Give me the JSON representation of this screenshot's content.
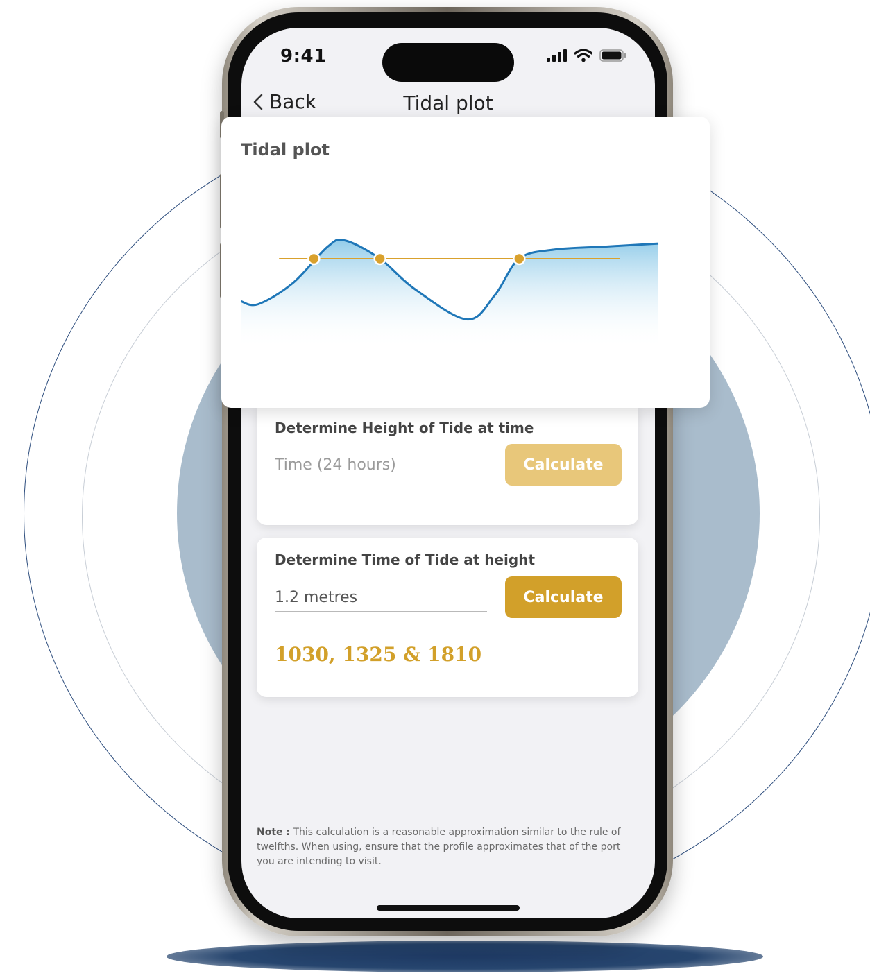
{
  "colors": {
    "accent_gold": "#d2a02a",
    "accent_gold_muted": "#e8c77a",
    "curve_blue": "#1f77b8",
    "fill_blue": "#8cc9e8",
    "background_disc": "#a9bccc",
    "ring_navy": "#2f4f7f",
    "screen_bg": "#f2f2f5"
  },
  "status_bar": {
    "time": "9:41",
    "icons": [
      "signal-icon",
      "wifi-icon",
      "battery-icon"
    ]
  },
  "nav": {
    "back_label": "Back",
    "back_icon": "chevron-left-icon",
    "title": "Tidal plot"
  },
  "plot": {
    "title": "Tidal plot"
  },
  "height_at_time": {
    "title": "Determine Height of Tide at time",
    "input_value": "",
    "input_placeholder": "Time (24 hours)",
    "button_label": "Calculate"
  },
  "time_at_height": {
    "title": "Determine Time of Tide at height",
    "input_value": "1.2 metres",
    "input_placeholder": "",
    "button_label": "Calculate",
    "result": "1030, 1325 & 1810"
  },
  "note": {
    "label": "Note :",
    "text": "This calculation is a reasonable approximation similar to the rule of twelfths. When using, ensure that the profile approximates that of the port you are intending to visit."
  },
  "chart_data": {
    "type": "line",
    "title": "Tidal plot",
    "xlabel": "",
    "ylabel": "",
    "grid": false,
    "legend": "none",
    "series": [
      {
        "x": [
          0,
          0.5,
          1.5,
          2.5,
          3.0,
          4.0,
          5.0,
          6.5,
          7.3,
          8.0,
          9.0,
          10.5,
          12.0
        ],
        "values": [
          0.5,
          0.45,
          0.8,
          1.4,
          1.5,
          1.2,
          0.7,
          0.2,
          0.6,
          1.2,
          1.35,
          1.4,
          1.45
        ]
      }
    ],
    "reference_line": {
      "y": 1.2
    },
    "markers": [
      {
        "x": 2.1,
        "y": 1.2
      },
      {
        "x": 4.0,
        "y": 1.2
      },
      {
        "x": 8.0,
        "y": 1.2
      }
    ]
  }
}
